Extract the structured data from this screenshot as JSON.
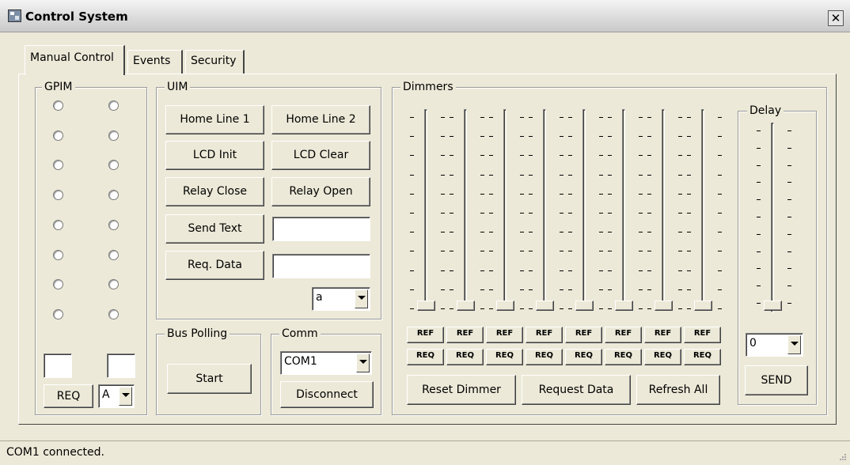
{
  "window": {
    "title": "Control System",
    "close_glyph": "✕"
  },
  "tabs": [
    {
      "label": "Manual Control",
      "active": true
    },
    {
      "label": "Events",
      "active": false
    },
    {
      "label": "Security",
      "active": false
    }
  ],
  "gpim": {
    "label": "GPIM",
    "radio_rows": 8,
    "box_left_value": "",
    "box_right_value": "",
    "req_label": "REQ",
    "select_value": "A"
  },
  "uim": {
    "label": "UIM",
    "buttons": {
      "home1": "Home Line 1",
      "home2": "Home Line 2",
      "lcd_init": "LCD Init",
      "lcd_clear": "LCD Clear",
      "relay_close": "Relay Close",
      "relay_open": "Relay Open",
      "send_text": "Send Text",
      "req_data": "Req. Data"
    },
    "send_text_value": "",
    "req_data_value": "",
    "select_value": "a"
  },
  "bus_polling": {
    "label": "Bus Polling",
    "start_label": "Start"
  },
  "comm": {
    "label": "Comm",
    "port_value": "COM1",
    "disconnect_label": "Disconnect"
  },
  "dimmers": {
    "label": "Dimmers",
    "count": 8,
    "values": [
      0,
      0,
      0,
      0,
      0,
      0,
      0,
      0
    ],
    "ref_label": "REF",
    "req_label": "REQ",
    "reset_label": "Reset Dimmer",
    "request_label": "Request Data",
    "refresh_label": "Refresh All"
  },
  "delay": {
    "label": "Delay",
    "value": 0,
    "select_value": "0",
    "send_label": "SEND"
  },
  "status_bar": {
    "text": "COM1 connected."
  },
  "icons": [
    "window-icon",
    "close-icon",
    "dropdown-arrow-icon",
    "resize-grip-icon"
  ]
}
